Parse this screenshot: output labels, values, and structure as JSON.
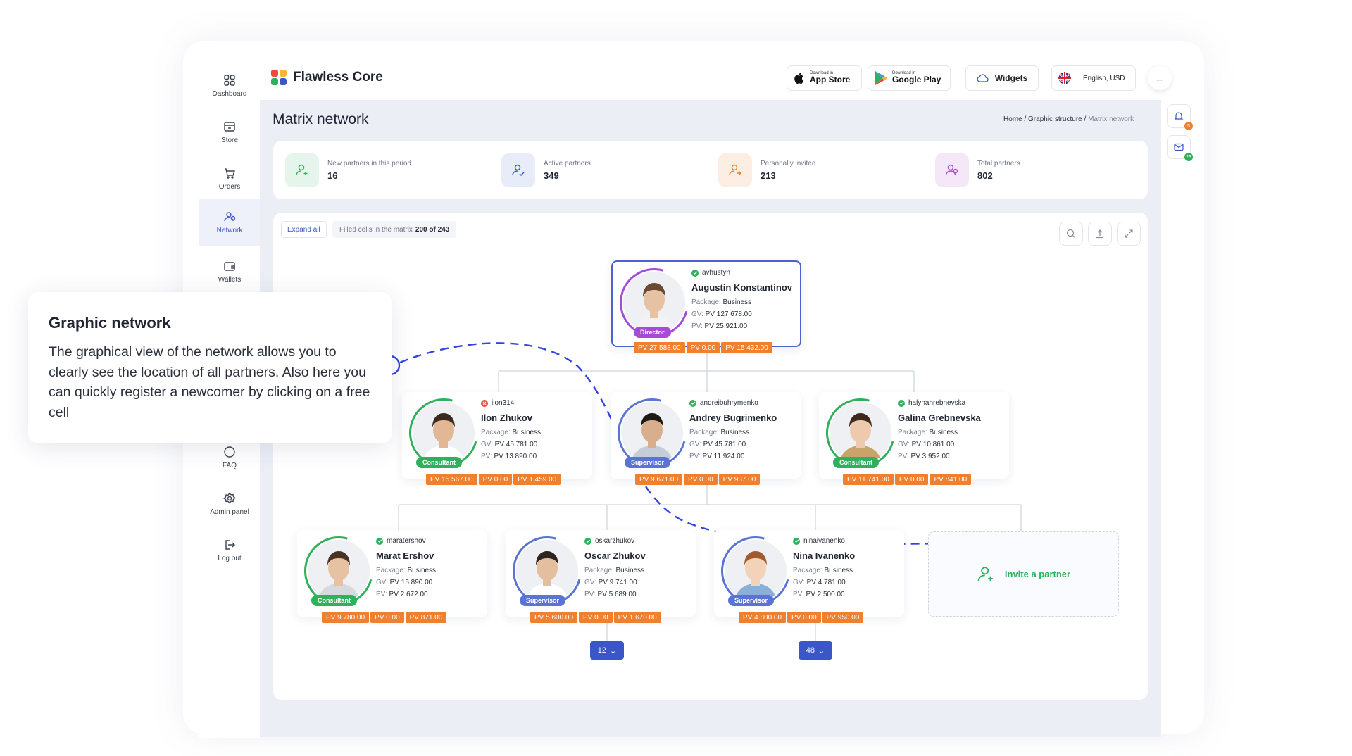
{
  "app": {
    "brand": "Flawless Core",
    "brand_colors": [
      "#e94b3c",
      "#f7b733",
      "#2fb05b",
      "#3b56c6"
    ]
  },
  "sidebar": {
    "items": [
      {
        "label": "Dashboard",
        "icon": "grid-icon"
      },
      {
        "label": "Store",
        "icon": "store-icon"
      },
      {
        "label": "Orders",
        "icon": "cart-icon"
      },
      {
        "label": "Network",
        "icon": "network-icon",
        "active": true
      },
      {
        "label": "Wallets",
        "icon": "wallet-icon"
      },
      {
        "label": "FAQ",
        "icon": "question-icon"
      },
      {
        "label": "Admin panel",
        "icon": "gear-icon"
      },
      {
        "label": "Log out",
        "icon": "logout-icon"
      }
    ]
  },
  "header": {
    "app_store": {
      "small": "Download in",
      "large": "App Store"
    },
    "google_play": {
      "small": "Download in",
      "large": "Google Play"
    },
    "widgets": "Widgets",
    "language": "English, USD"
  },
  "notifications": {
    "bell_count": "5",
    "mail_count": "23"
  },
  "page": {
    "title": "Matrix network",
    "breadcrumb": {
      "home": "Home",
      "sep1": " / ",
      "section": "Graphic structure",
      "sep2": " / ",
      "current": "Matrix network"
    }
  },
  "stats": [
    {
      "label": "New partners in this period",
      "value": "16",
      "color": "#2fb05b",
      "bg": "#e6f5ec"
    },
    {
      "label": "Active partners",
      "value": "349",
      "color": "#3b56c6",
      "bg": "#e8ecf8"
    },
    {
      "label": "Personally invited",
      "value": "213",
      "color": "#f07f2e",
      "bg": "#fdeee3"
    },
    {
      "label": "Total partners",
      "value": "802",
      "color": "#a54cc6",
      "bg": "#f4e8f8"
    }
  ],
  "matrix": {
    "expand_all": "Expand all",
    "filled_label": "Filled cells in the matrix",
    "filled_value": "200 of 243",
    "package_label": "Package:",
    "gv_label": "GV:",
    "pv_label": "PV:",
    "invite": "Invite a partner"
  },
  "partners": [
    {
      "username": "avhustyn",
      "status": "active",
      "name": "Augustin Konstantinov",
      "package": "Business",
      "gv": "PV 127 678.00",
      "pv": "PV 25 921.00",
      "rank": "Director",
      "pv_bar": [
        "PV 27 588.00",
        "PV 0.00",
        "PV 15 432.00"
      ]
    },
    {
      "username": "ilon314",
      "status": "inactive",
      "name": "Ilon Zhukov",
      "package": "Business",
      "gv": "PV 45 781.00",
      "pv": "PV 13 890.00",
      "rank": "Consultant",
      "pv_bar": [
        "PV 15 567.00",
        "PV 0.00",
        "PV 1 459.00"
      ]
    },
    {
      "username": "andreibuhrymenko",
      "status": "active",
      "name": "Andrey Bugrimenko",
      "package": "Business",
      "gv": "PV 45 781.00",
      "pv": "PV 11 924.00",
      "rank": "Supervisor",
      "pv_bar": [
        "PV 9 671.00",
        "PV 0.00",
        "PV 937.00"
      ]
    },
    {
      "username": "halynahrebnevska",
      "status": "active",
      "name": "Galina Grebnevska",
      "package": "Business",
      "gv": "PV 10 861.00",
      "pv": "PV 3 952.00",
      "rank": "Consultant",
      "pv_bar": [
        "PV 11 741.00",
        "PV 0.00",
        "PV 841.00"
      ]
    },
    {
      "username": "maratershov",
      "status": "active",
      "name": "Marat Ershov",
      "package": "Business",
      "gv": "PV 15 890.00",
      "pv": "PV 2 672.00",
      "rank": "Consultant",
      "pv_bar": [
        "PV 9 780.00",
        "PV 0.00",
        "PV 871.00"
      ]
    },
    {
      "username": "oskarzhukov",
      "status": "active",
      "name": "Oscar Zhukov",
      "package": "Business",
      "gv": "PV 9 741.00",
      "pv": "PV 5 689.00",
      "rank": "Supervisor",
      "pv_bar": [
        "PV 5 600.00",
        "PV 0.00",
        "PV 1 670.00"
      ],
      "more": "12"
    },
    {
      "username": "ninaivanenko",
      "status": "active",
      "name": "Nina Ivanenko",
      "package": "Business",
      "gv": "PV 4 781.00",
      "pv": "PV 2 500.00",
      "rank": "Supervisor",
      "pv_bar": [
        "PV 4 800.00",
        "PV 0.00",
        "PV 950.00"
      ],
      "more": "48"
    }
  ],
  "rank_colors": {
    "Director": "#a64ad9",
    "Consultant": "#2fb05b",
    "Supervisor": "#5a74d6"
  },
  "callout": {
    "title": "Graphic network",
    "text": "The graphical view of the network allows you to clearly see the location of all partners. Also here you can quickly register a newcomer by clicking on a free cell"
  }
}
